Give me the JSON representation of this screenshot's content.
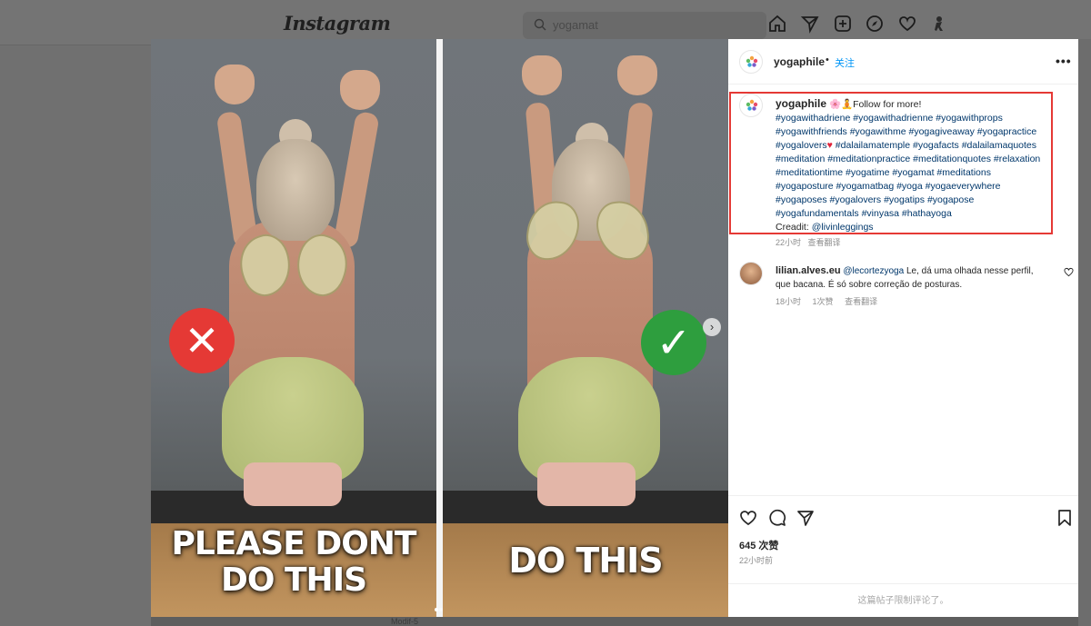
{
  "nav": {
    "logo": "Instagram",
    "search_value": "yogamat",
    "icons": [
      "home-icon",
      "direct-icon",
      "create-icon",
      "explore-icon",
      "activity-icon",
      "profile-icon"
    ]
  },
  "background": {
    "bottom_label": "Modif-5"
  },
  "post_image": {
    "left_caption_line1": "PLEASE DONT",
    "left_caption_line2": "DO THIS",
    "right_caption": "DO THIS",
    "wrong_badge": "✕",
    "right_badge": "✓",
    "next_button": "›"
  },
  "post": {
    "username": "yogaphile",
    "follow_separator": "•",
    "follow_label": "关注",
    "more_label": "•••",
    "caption": {
      "author": "yogaphile",
      "emojis": "🌸🧘",
      "text": "Follow for more!",
      "tags_line1": "#yogawithadriene #yogawithadrienne #yogawithprops",
      "tags_line2": "#yogawithfriends #yogawithme #yogagiveaway #yogapractice",
      "tags_line3a": "#yogalovers",
      "tags_line3_heart": "♥",
      "tags_line3b": "#dalailamatemple #yogafacts #dalailamaquotes",
      "tags_line4": "#meditation #meditationpractice #meditationquotes #relaxation",
      "tags_line5": "#meditationtime #yogatime #yogamat #meditations",
      "tags_line6": "#yogaposture #yogamatbag #yoga #yogaeverywhere",
      "tags_line7": "#yogaposes #yogalovers #yogatips #yogapose",
      "tags_line8": "#yogafundamentals #vinyasa #hathayoga",
      "credit_label": "Creadit: ",
      "credit_mention": "@livinleggings",
      "time": "22小时",
      "translate": "查看翻译"
    },
    "comment": {
      "username": "lilian.alves.eu",
      "mention": "@lecortezyoga",
      "text_part1": " Le, dá uma olhada nesse perfil,",
      "text_part2": "que bacana. É só sobre correção de posturas.",
      "time": "18小时",
      "likes": "1次赞",
      "translate": "查看翻译"
    },
    "likes": "645 次赞",
    "posted": "22小时前",
    "comments_limited": "这篇帖子限制评论了。"
  },
  "colors": {
    "highlight_border": "#e53935",
    "link_blue": "#0095f6",
    "hashtag": "#00376b",
    "wrong": "#e53935",
    "correct": "#2e9e3e"
  }
}
